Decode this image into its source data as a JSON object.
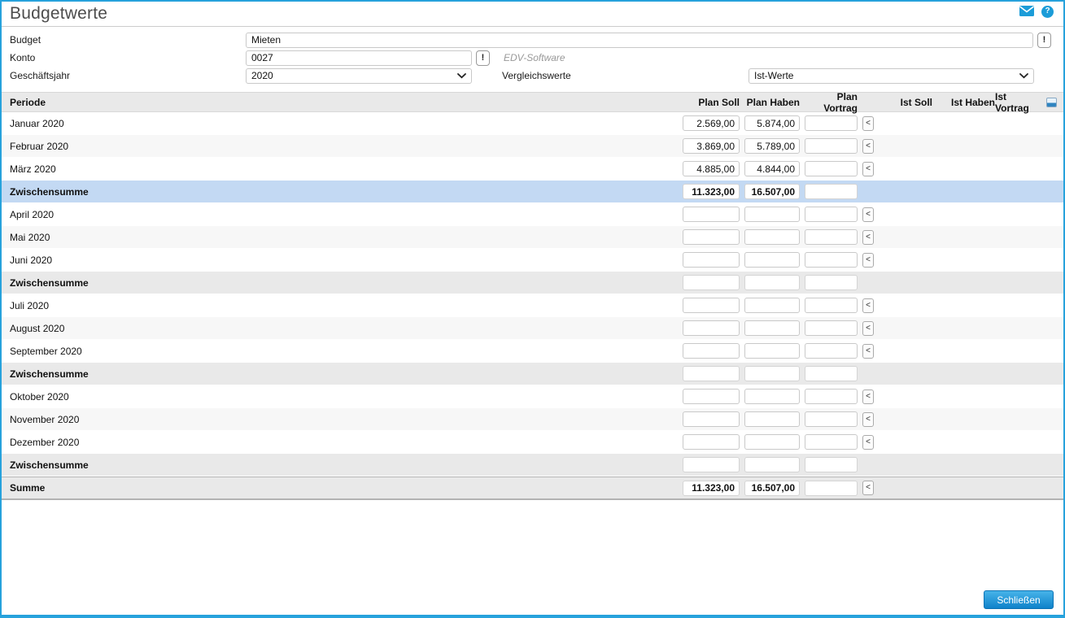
{
  "window": {
    "title": "Budgetwerte"
  },
  "header_icons": {
    "email": "envelope-icon",
    "help": "?"
  },
  "form": {
    "budget": {
      "label": "Budget",
      "value": "Mieten",
      "action_label": "!"
    },
    "konto": {
      "label": "Konto",
      "value": "0027",
      "action_label": "!",
      "description": "EDV-Software"
    },
    "geschaeftsjahr": {
      "label": "Geschäftsjahr",
      "value": "2020"
    },
    "vergleichswerte": {
      "label": "Vergleichswerte",
      "value": "Ist-Werte"
    }
  },
  "table": {
    "columns": [
      "Periode",
      "Plan Soll",
      "Plan Haben",
      "Plan Vortrag",
      "Ist Soll",
      "Ist Haben",
      "Ist Vortrag"
    ],
    "copy_button_label": "<",
    "rows": [
      {
        "label": "Januar 2020",
        "style": "white",
        "plan_soll": "2.569,00",
        "plan_haben": "5.874,00",
        "plan_vortrag": "",
        "copy_button": true
      },
      {
        "label": "Februar 2020",
        "style": "gray",
        "plan_soll": "3.869,00",
        "plan_haben": "5.789,00",
        "plan_vortrag": "",
        "copy_button": true
      },
      {
        "label": "März 2020",
        "style": "white",
        "plan_soll": "4.885,00",
        "plan_haben": "4.844,00",
        "plan_vortrag": "",
        "copy_button": true
      },
      {
        "label": "Zwischensumme",
        "style": "subtotal selected",
        "plan_soll": "11.323,00",
        "plan_haben": "16.507,00",
        "plan_vortrag": "",
        "copy_button": false
      },
      {
        "label": "April 2020",
        "style": "white",
        "plan_soll": "",
        "plan_haben": "",
        "plan_vortrag": "",
        "copy_button": true
      },
      {
        "label": "Mai 2020",
        "style": "gray",
        "plan_soll": "",
        "plan_haben": "",
        "plan_vortrag": "",
        "copy_button": true
      },
      {
        "label": "Juni 2020",
        "style": "white",
        "plan_soll": "",
        "plan_haben": "",
        "plan_vortrag": "",
        "copy_button": true
      },
      {
        "label": "Zwischensumme",
        "style": "subtotal",
        "plan_soll": "",
        "plan_haben": "",
        "plan_vortrag": "",
        "copy_button": false
      },
      {
        "label": "Juli 2020",
        "style": "white",
        "plan_soll": "",
        "plan_haben": "",
        "plan_vortrag": "",
        "copy_button": true
      },
      {
        "label": "August 2020",
        "style": "gray",
        "plan_soll": "",
        "plan_haben": "",
        "plan_vortrag": "",
        "copy_button": true
      },
      {
        "label": "September 2020",
        "style": "white",
        "plan_soll": "",
        "plan_haben": "",
        "plan_vortrag": "",
        "copy_button": true
      },
      {
        "label": "Zwischensumme",
        "style": "subtotal",
        "plan_soll": "",
        "plan_haben": "",
        "plan_vortrag": "",
        "copy_button": false
      },
      {
        "label": "Oktober 2020",
        "style": "white",
        "plan_soll": "",
        "plan_haben": "",
        "plan_vortrag": "",
        "copy_button": true
      },
      {
        "label": "November 2020",
        "style": "gray",
        "plan_soll": "",
        "plan_haben": "",
        "plan_vortrag": "",
        "copy_button": true
      },
      {
        "label": "Dezember 2020",
        "style": "white",
        "plan_soll": "",
        "plan_haben": "",
        "plan_vortrag": "",
        "copy_button": true
      },
      {
        "label": "Zwischensumme",
        "style": "subtotal",
        "plan_soll": "",
        "plan_haben": "",
        "plan_vortrag": "",
        "copy_button": false
      },
      {
        "label": "Summe",
        "style": "total",
        "plan_soll": "11.323,00",
        "plan_haben": "16.507,00",
        "plan_vortrag": "",
        "copy_button": true
      }
    ]
  },
  "footer": {
    "close_label": "Schließen"
  },
  "colors": {
    "accent_blue": "#1b9cd8",
    "window_border": "#27a2dc",
    "selected_row": "#c3d9f3",
    "summary_row": "#e9e9e9",
    "zebra_row": "#f7f7f7",
    "close_button_top": "#46b3e9",
    "close_button_bottom": "#0f82ca"
  }
}
